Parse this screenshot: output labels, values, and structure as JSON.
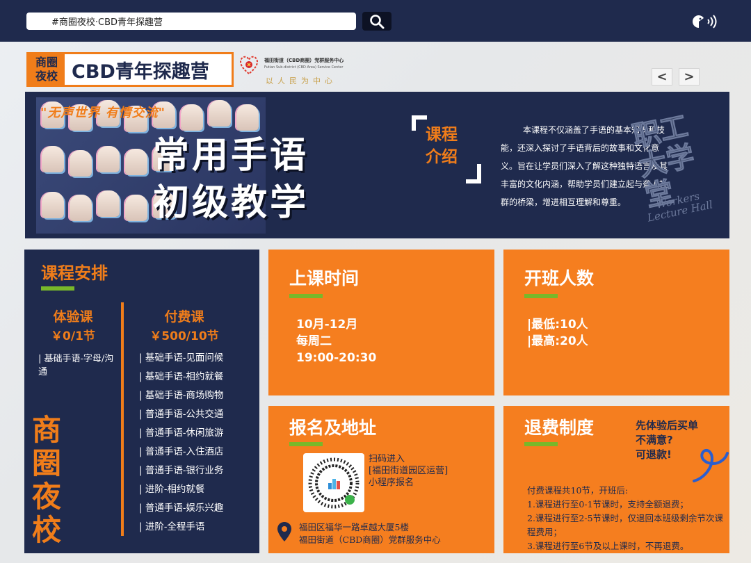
{
  "search": {
    "value": "#商圈夜校·CBD青年探趣营"
  },
  "brand": {
    "tag_line1": "商圈",
    "tag_line2": "夜校",
    "title": "CBD青年探趣营"
  },
  "org": {
    "name": "福田街道（CBD商圈）党群服务中心",
    "name_en": "Futian Sub-district (CBD Area) Service Center",
    "motto": "以人民为中心"
  },
  "nav": {
    "prev": "<",
    "next": ">"
  },
  "banner": {
    "slogan": "\"无声世界 有情交流\"",
    "title_line1": "常用手语",
    "title_line2": "初级教学",
    "intro_label_line1": "课程",
    "intro_label_line2": "介绍",
    "intro_text": "本课程不仅涵盖了手语的基本知识和技能，还深入探讨了手语背后的故事和文化意义。旨在让学员们深入了解这种独特语言及其丰富的文化内涵，帮助学员们建立起与聋人社群的桥梁，增进相互理解和尊重。",
    "stamp_cn_line1": "职工",
    "stamp_cn_line2": "大学堂",
    "stamp_en": "Workers Lecture Hall"
  },
  "schedule": {
    "title": "课程安排",
    "trial": {
      "label": "体验课",
      "price": "￥0/1节",
      "item": "| 基础手语-字母/沟通"
    },
    "paid": {
      "label": "付费课",
      "price": "￥500/10节",
      "items": [
        "| 基础手语-见面问候",
        "| 基础手语-相约就餐",
        "| 基础手语-商场购物",
        "| 普通手语-公共交通",
        "| 普通手语-休闲旅游",
        "| 普通手语-入住酒店",
        "| 普通手语-银行业务",
        "| 进阶-相约就餐",
        "| 普通手语-娱乐兴趣",
        "| 进阶-全程手语"
      ]
    },
    "vertical_name": "商圈夜校"
  },
  "time_card": {
    "title": "上课时间",
    "line1": "10月-12月",
    "line2": "每周二",
    "line3": "19:00-20:30"
  },
  "size_card": {
    "title": "开班人数",
    "line1": "|最低:10人",
    "line2": "|最高:20人"
  },
  "register_card": {
    "title": "报名及地址",
    "scan_line1": "扫码进入",
    "scan_line2": "[福田街道园区运营]",
    "scan_line3": "小程序报名",
    "address_line1": "福田区福华一路卓越大厦5楼",
    "address_line2": "福田街道（CBD商圈）党群服务中心"
  },
  "refund_card": {
    "title": "退费制度",
    "note_line1": "先体验后买单",
    "note_line2": "不满意?",
    "note_line3": "可退款!",
    "body_line1": "付费课程共10节，开班后:",
    "body_line2": "1.课程进行至0-1节课时，支持全额退费；",
    "body_line3": "2.课程进行至2-5节课时，仅退回本班级剩余节次课程费用；",
    "body_line4": "3.课程进行至6节及以上课时，不再退费。"
  },
  "colors": {
    "navy": "#1f2a4d",
    "orange": "#f57e1f",
    "green": "#78b82a"
  }
}
